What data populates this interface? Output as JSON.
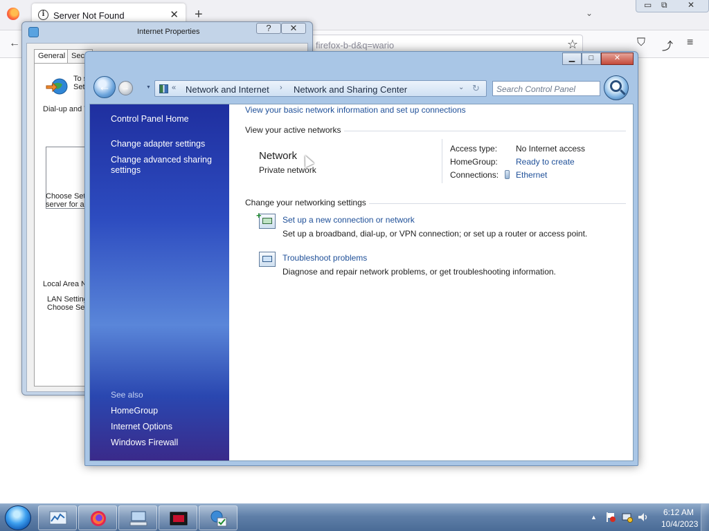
{
  "firefox": {
    "tab_title": "Server Not Found",
    "tab_close": "✕",
    "new_tab": "+",
    "tabs_menu": "⌄",
    "url_text": "firefox-b-d&q=wario",
    "back_glyph": "←",
    "star_glyph": "☆",
    "minimize_glyph": "▭",
    "maximize_glyph": "⧉",
    "close_glyph": "✕",
    "tools": [
      "⛉",
      "⤴",
      "≡"
    ]
  },
  "internet_properties": {
    "title": "Internet Properties",
    "help_glyph": "?",
    "close_glyph": "✕",
    "tabs": [
      "General",
      "Secu"
    ],
    "lines": {
      "setup_a": "To s",
      "setup_b": "Set",
      "dialup": "Dial-up and V",
      "choose_a": "Choose Set",
      "choose_b": "server for a",
      "lan_header": "Local Area N",
      "lan_a": "LAN Setting",
      "lan_b": "Choose Set"
    }
  },
  "network_center": {
    "caption": {
      "minimize": "▁",
      "maximize": "□",
      "close": "✕"
    },
    "nav": {
      "back": "←",
      "forward": "→",
      "recent": "▼"
    },
    "breadcrumb": {
      "chevron_lead": "«",
      "items": [
        "Network and Internet",
        "Network and Sharing Center"
      ],
      "separator": "›",
      "dropdown": "⌄",
      "refresh": "↻"
    },
    "search_placeholder": "Search Control Panel",
    "sidebar": {
      "home": "Control Panel Home",
      "links": [
        "Change adapter settings",
        "Change advanced sharing settings"
      ],
      "see_also_label": "See also",
      "see_also": [
        "HomeGroup",
        "Internet Options",
        "Windows Firewall"
      ]
    },
    "main": {
      "top_link": "View your basic network information and set up connections",
      "active_header": "View your active networks",
      "network_name": "Network",
      "network_type": "Private network",
      "access_type_label": "Access type:",
      "access_type_value": "No Internet access",
      "homegroup_label": "HomeGroup:",
      "homegroup_value": "Ready to create",
      "connections_label": "Connections:",
      "connections_value": "Ethernet",
      "change_header": "Change your networking settings",
      "tasks": [
        {
          "link": "Set up a new connection or network",
          "desc": "Set up a broadband, dial-up, or VPN connection; or set up a router or access point.",
          "icon": "new-connection-icon"
        },
        {
          "link": "Troubleshoot problems",
          "desc": "Diagnose and repair network problems, or get troubleshooting information.",
          "icon": "troubleshoot-icon"
        }
      ]
    }
  },
  "taskbar": {
    "buttons": [
      "resource-monitor-icon",
      "firefox-icon",
      "network-computer-icon",
      "media-app-icon",
      "control-panel-icon"
    ],
    "tray_arrow": "▲",
    "time": "6:12 AM",
    "date": "10/4/2023"
  },
  "colors": {
    "link": "#1e4f98",
    "sidebar_top": "#1f2f9f",
    "sidebar_mid": "#5a86d9",
    "taskbar": "#5f7fa8"
  }
}
